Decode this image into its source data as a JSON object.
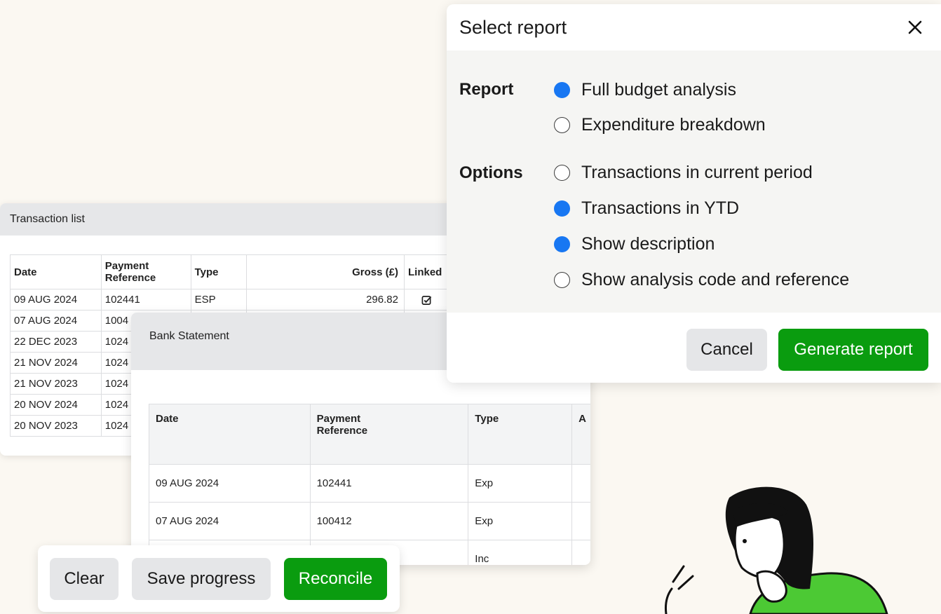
{
  "transaction_list": {
    "title": "Transaction list",
    "columns": [
      "Date",
      "Payment\nReference",
      "Type",
      "Gross (£)",
      "Linked"
    ],
    "rows": [
      {
        "date": "09 AUG 2024",
        "ref": "102441",
        "type": "ESP",
        "gross": "296.82",
        "linked": "checked-box-icon"
      },
      {
        "date": "07 AUG 2024",
        "ref": "1004",
        "type": "",
        "gross": "",
        "linked": ""
      },
      {
        "date": "22 DEC 2023",
        "ref": "1024",
        "type": "",
        "gross": "",
        "linked": ""
      },
      {
        "date": "21 NOV 2024",
        "ref": "1024",
        "type": "",
        "gross": "",
        "linked": ""
      },
      {
        "date": "21 NOV 2023",
        "ref": "1024",
        "type": "",
        "gross": "",
        "linked": ""
      },
      {
        "date": "20 NOV 2024",
        "ref": "1024",
        "type": "",
        "gross": "",
        "linked": ""
      },
      {
        "date": "20 NOV 2023",
        "ref": "1024",
        "type": "",
        "gross": "",
        "linked": ""
      }
    ]
  },
  "bank_statement": {
    "title": "Bank Statement",
    "columns": [
      "Date",
      "Payment\nReference",
      "Type",
      "A"
    ],
    "rows": [
      {
        "date": "09 AUG 2024",
        "ref": "102441",
        "type": "Exp"
      },
      {
        "date": "07 AUG 2024",
        "ref": "100412",
        "type": "Exp"
      },
      {
        "date": "",
        "ref": "",
        "type": "Inc"
      }
    ]
  },
  "modal": {
    "title": "Select report",
    "report_label": "Report",
    "options_label": "Options",
    "report_choices": [
      {
        "label": "Full budget analysis",
        "selected": true
      },
      {
        "label": "Expenditure breakdown",
        "selected": false
      }
    ],
    "option_choices": [
      {
        "label": "Transactions in current period",
        "selected": false
      },
      {
        "label": "Transactions in YTD",
        "selected": true
      },
      {
        "label": "Show description",
        "selected": true
      },
      {
        "label": "Show analysis code and reference",
        "selected": false
      }
    ],
    "cancel_label": "Cancel",
    "generate_label": "Generate report"
  },
  "action_bar": {
    "clear_label": "Clear",
    "save_label": "Save progress",
    "reconcile_label": "Reconcile"
  },
  "colors": {
    "accent_green": "#0a9c0f",
    "radio_blue": "#1877f2",
    "illustration_green": "#4cc934"
  }
}
